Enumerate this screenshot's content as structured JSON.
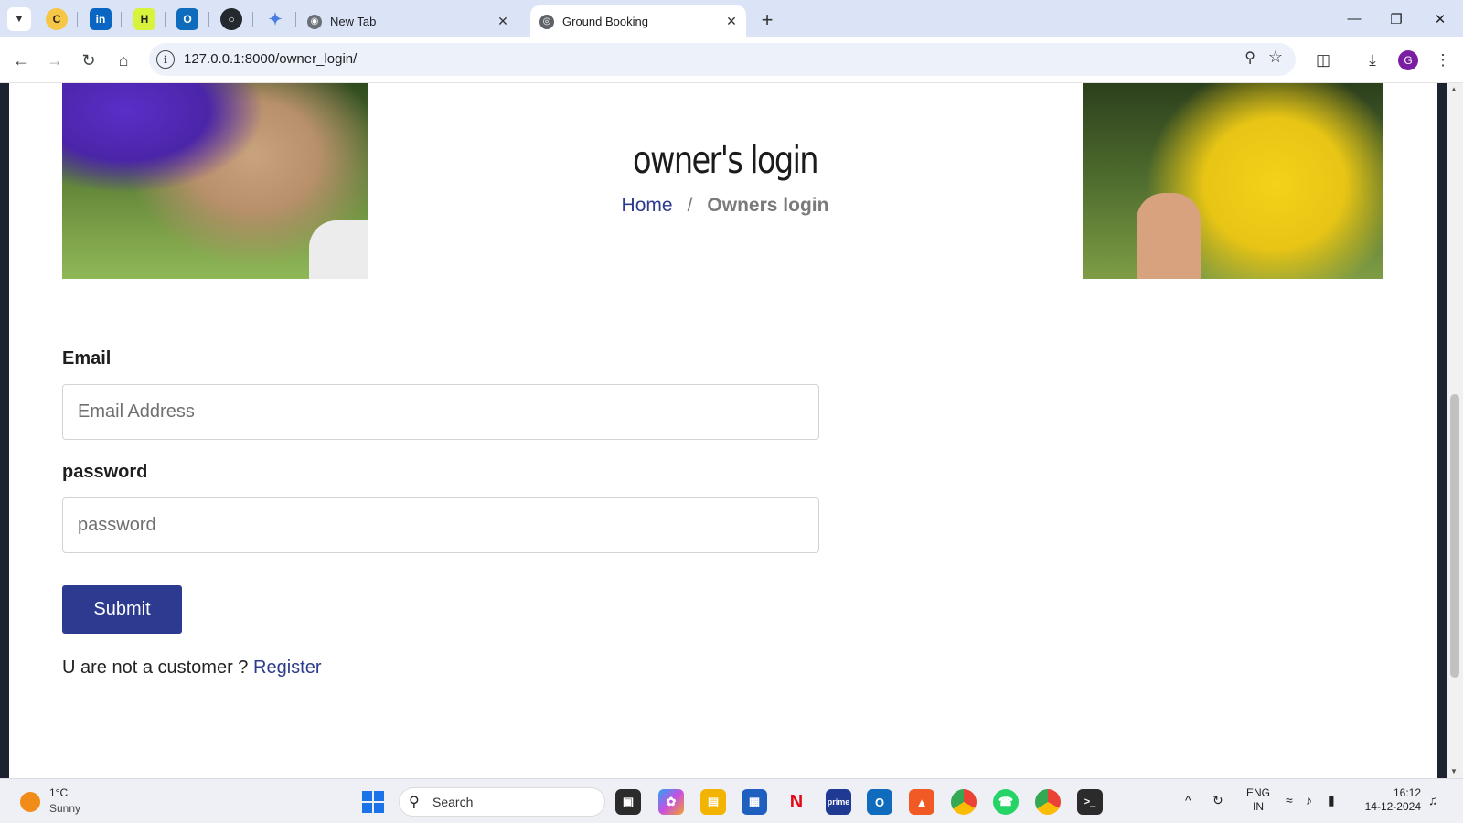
{
  "browser": {
    "tabs": [
      {
        "title": "New Tab",
        "active": false
      },
      {
        "title": "Ground Booking",
        "active": true
      }
    ],
    "url": "127.0.0.1:8000/owner_login/",
    "profile_initial": "G",
    "pinned_icons": [
      "c-icon",
      "linkedin-icon",
      "hashnode-icon",
      "outlook-icon",
      "github-icon",
      "gemini-icon"
    ]
  },
  "page": {
    "hero_title": "owner's login",
    "breadcrumb": {
      "home": "Home",
      "separator": "/",
      "current": "Owners login"
    },
    "form": {
      "email_label": "Email",
      "email_placeholder": "Email Address",
      "password_label": "password",
      "password_placeholder": "password",
      "submit_label": "Submit",
      "register_prompt": "U are not a customer ?",
      "register_link": "Register"
    },
    "colors": {
      "primary": "#2c3a8f",
      "link": "#2d3b8c"
    }
  },
  "taskbar": {
    "weather_temp": "1°C",
    "weather_desc": "Sunny",
    "search_placeholder": "Search",
    "lang_top": "ENG",
    "lang_bottom": "IN",
    "time": "16:12",
    "date": "14-12-2024"
  }
}
